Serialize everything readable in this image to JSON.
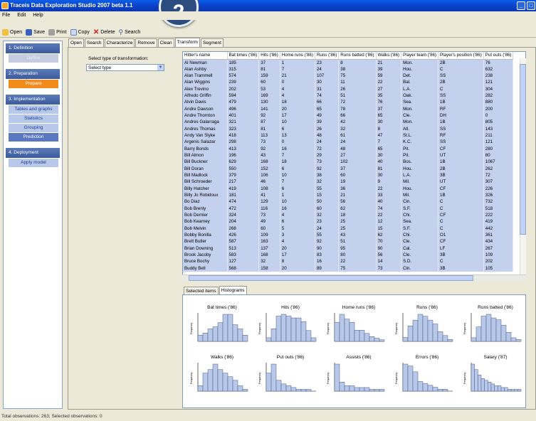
{
  "window": {
    "title": "Traceis Data Exploration Studio 2007 beta 1.1",
    "step_number": "2"
  },
  "menu": [
    "File",
    "Edit",
    "Help"
  ],
  "toolbar": {
    "open": "Open",
    "save": "Save",
    "print": "Print",
    "copy": "Copy",
    "delete": "Delete",
    "search": "Search"
  },
  "sidebar": {
    "sections": [
      {
        "header": "1. Definition",
        "items": [
          {
            "label": "Define",
            "state": "disabled"
          }
        ]
      },
      {
        "header": "2. Preparation",
        "items": [
          {
            "label": "Prepare",
            "state": "active"
          }
        ]
      },
      {
        "header": "3. Implementation",
        "items": [
          {
            "label": "Tables and graphs",
            "state": "normal"
          },
          {
            "label": "Statistics",
            "state": "normal"
          },
          {
            "label": "Grouping",
            "state": "normal"
          },
          {
            "label": "Prediction",
            "state": "blue"
          }
        ]
      },
      {
        "header": "4. Deployment",
        "items": [
          {
            "label": "Apply model",
            "state": "normal"
          }
        ]
      }
    ]
  },
  "tabs": [
    "Open",
    "Search",
    "Characterize",
    "Remove",
    "Clean",
    "Transform",
    "Segment"
  ],
  "active_tab": "Transform",
  "transform": {
    "label": "Select type of transformation:",
    "select_value": "Select type"
  },
  "table": {
    "columns": [
      "Hitter's name",
      "Bat times ('86)",
      "Hits ('86)",
      "Home runs ('86)",
      "Runs ('86)",
      "Runs batted ('86)",
      "Walks ('86)",
      "Player team ('86)",
      "Player's position ('86)",
      "Put outs ('86)"
    ],
    "rows": [
      [
        "Al Newman",
        "185",
        "37",
        "1",
        "23",
        "8",
        "21",
        "Mon.",
        "2B",
        "76"
      ],
      [
        "Alan Ashby",
        "315",
        "81",
        "7",
        "24",
        "38",
        "39",
        "Hou.",
        "C",
        "632"
      ],
      [
        "Alan Trammell",
        "574",
        "159",
        "21",
        "107",
        "75",
        "59",
        "Det.",
        "SS",
        "238"
      ],
      [
        "Alan Wiggins",
        "239",
        "60",
        "0",
        "30",
        "11",
        "22",
        "Bal.",
        "2B",
        "121"
      ],
      [
        "Alex Trevino",
        "202",
        "53",
        "4",
        "31",
        "26",
        "27",
        "L.A.",
        "C",
        "304"
      ],
      [
        "Alfredo Griffin",
        "594",
        "169",
        "4",
        "74",
        "51",
        "35",
        "Oak.",
        "SS",
        "282"
      ],
      [
        "Alvin Davis",
        "479",
        "130",
        "18",
        "66",
        "72",
        "76",
        "Sea.",
        "1B",
        "880"
      ],
      [
        "Andre Dawson",
        "496",
        "141",
        "20",
        "65",
        "78",
        "37",
        "Mon.",
        "RF",
        "200"
      ],
      [
        "Andre Thornton",
        "401",
        "92",
        "17",
        "49",
        "66",
        "65",
        "Cle.",
        "DH",
        "0"
      ],
      [
        "Andres Galarraga",
        "321",
        "87",
        "10",
        "39",
        "42",
        "30",
        "Mon.",
        "1B",
        "805"
      ],
      [
        "Andres Thomas",
        "323",
        "81",
        "6",
        "26",
        "32",
        "8",
        "Atl.",
        "SS",
        "143"
      ],
      [
        "Andy Van Slyke",
        "418",
        "113",
        "13",
        "48",
        "61",
        "47",
        "St.L.",
        "RF",
        "211"
      ],
      [
        "Argenis Salazar",
        "298",
        "73",
        "0",
        "24",
        "24",
        "7",
        "K.C.",
        "SS",
        "121"
      ],
      [
        "Barry Bonds",
        "413",
        "92",
        "16",
        "72",
        "48",
        "65",
        "Pit.",
        "CF",
        "280"
      ],
      [
        "Bill Almon",
        "196",
        "43",
        "7",
        "29",
        "27",
        "30",
        "Pit.",
        "UT",
        "80"
      ],
      [
        "Bill Buckner",
        "629",
        "168",
        "18",
        "73",
        "102",
        "40",
        "Bos.",
        "1B",
        "1067"
      ],
      [
        "Bill Doran",
        "550",
        "152",
        "6",
        "92",
        "37",
        "81",
        "Hou.",
        "2B",
        "262"
      ],
      [
        "Bill Madlock",
        "379",
        "106",
        "10",
        "38",
        "60",
        "30",
        "L.A.",
        "3B",
        "72"
      ],
      [
        "Bill Schroeder",
        "217",
        "46",
        "7",
        "32",
        "19",
        "9",
        "Mil.",
        "UT",
        "307"
      ],
      [
        "Billy Hatcher",
        "419",
        "108",
        "6",
        "55",
        "36",
        "22",
        "Hou.",
        "CF",
        "226"
      ],
      [
        "Billy Jo Robidoux",
        "181",
        "41",
        "1",
        "15",
        "21",
        "33",
        "Mil.",
        "1B",
        "326"
      ],
      [
        "Bo Diaz",
        "474",
        "129",
        "10",
        "50",
        "56",
        "40",
        "Cin.",
        "C",
        "732"
      ],
      [
        "Bob Brenly",
        "472",
        "116",
        "16",
        "60",
        "62",
        "74",
        "S.F.",
        "C",
        "518"
      ],
      [
        "Bob Dernier",
        "324",
        "73",
        "4",
        "32",
        "18",
        "22",
        "Chi.",
        "CF",
        "222"
      ],
      [
        "Bob Kearney",
        "204",
        "49",
        "6",
        "23",
        "25",
        "12",
        "Sea.",
        "C",
        "419"
      ],
      [
        "Bob Melvin",
        "268",
        "60",
        "5",
        "24",
        "25",
        "15",
        "S.F.",
        "C",
        "442"
      ],
      [
        "Bobby Bonilla",
        "426",
        "109",
        "3",
        "55",
        "43",
        "62",
        "Chi.",
        "O1",
        "361"
      ],
      [
        "Brett Butler",
        "587",
        "163",
        "4",
        "92",
        "51",
        "70",
        "Cle.",
        "CF",
        "434"
      ],
      [
        "Brian Downing",
        "513",
        "137",
        "20",
        "90",
        "95",
        "90",
        "Cal.",
        "LF",
        "267"
      ],
      [
        "Brook Jacoby",
        "583",
        "168",
        "17",
        "83",
        "80",
        "56",
        "Cle.",
        "3B",
        "109"
      ],
      [
        "Bruce Bochy",
        "127",
        "32",
        "8",
        "16",
        "22",
        "14",
        "S.D.",
        "C",
        "202"
      ],
      [
        "Buddy Bell",
        "568",
        "158",
        "20",
        "89",
        "75",
        "73",
        "Cin.",
        "3B",
        "105"
      ]
    ]
  },
  "bottom_tabs": [
    "Selected items",
    "Histograms"
  ],
  "active_bottom_tab": "Histograms",
  "chart_data": [
    {
      "type": "bar",
      "title": "Bat times ('86)",
      "ylabel": "Frequency",
      "values": [
        3,
        4,
        6,
        7,
        9,
        13,
        13,
        8,
        6,
        3
      ]
    },
    {
      "type": "bar",
      "title": "Hits ('86)",
      "ylabel": "Frequency",
      "values": [
        2,
        7,
        14,
        15,
        14,
        13,
        13,
        11,
        6,
        2
      ]
    },
    {
      "type": "bar",
      "title": "Home runs ('86)",
      "ylabel": "Frequency",
      "values": [
        12,
        17,
        14,
        12,
        7,
        7,
        5,
        3,
        2,
        1
      ]
    },
    {
      "type": "bar",
      "title": "Runs ('86)",
      "ylabel": "Frequency",
      "values": [
        2,
        8,
        11,
        14,
        13,
        11,
        9,
        5,
        3,
        1
      ]
    },
    {
      "type": "bar",
      "title": "Runs batted ('86)",
      "ylabel": "Frequency",
      "values": [
        2,
        8,
        14,
        15,
        13,
        12,
        9,
        5,
        2,
        1
      ]
    },
    {
      "type": "bar",
      "title": "Walks ('86)",
      "ylabel": "Frequency",
      "values": [
        3,
        10,
        12,
        15,
        12,
        10,
        8,
        6,
        3,
        1
      ]
    },
    {
      "type": "bar",
      "title": "Put outs ('86)",
      "ylabel": "Frequency",
      "values": [
        10,
        15,
        6,
        4,
        3,
        2,
        1,
        1,
        1,
        0
      ]
    },
    {
      "type": "bar",
      "title": "Assists ('86)",
      "ylabel": "Frequency",
      "values": [
        15,
        5,
        3,
        3,
        2,
        2,
        2,
        1,
        1,
        1
      ]
    },
    {
      "type": "bar",
      "title": "Errors ('86)",
      "ylabel": "Frequency",
      "values": [
        14,
        13,
        10,
        5,
        4,
        3,
        2,
        1,
        1,
        0
      ]
    },
    {
      "type": "bar",
      "title": "Salary ('87)",
      "ylabel": "Frequency",
      "values": [
        15,
        12,
        9,
        7,
        6,
        5,
        4,
        3,
        3,
        2,
        2,
        1,
        1,
        1,
        1
      ]
    }
  ],
  "colors": {
    "title_blue": "#0a40c8",
    "bar_fill": "#b8c8e8",
    "active_orange": "#f28a1c",
    "table_bg": "#c3d0ee"
  },
  "status": "Total observations: 263; Selected observations: 0"
}
